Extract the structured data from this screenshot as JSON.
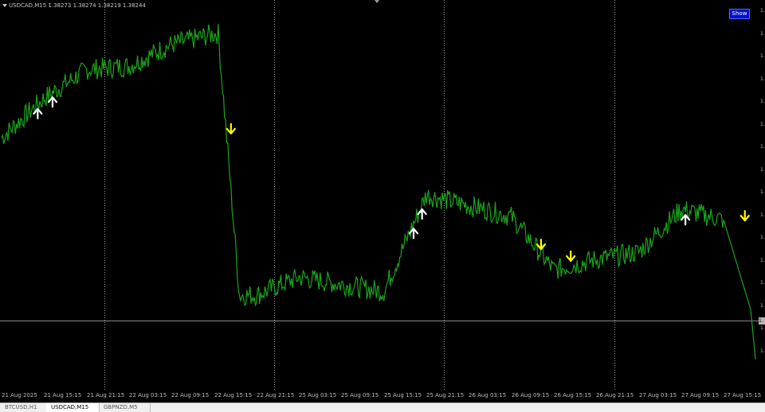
{
  "header": {
    "text": "USDCAD,M15  1.38273 1.38274 1.38219 1.38244"
  },
  "show_button": {
    "label": "Show"
  },
  "price_axis": {
    "ticks": [
      "1.",
      "1.",
      "1.",
      "1.",
      "1.",
      "1.",
      "1.",
      "1.",
      "1.",
      "1.",
      "1.",
      "1.",
      "1.",
      "1.",
      "1.",
      "1."
    ],
    "current_label": "1."
  },
  "time_axis": {
    "labels": [
      "21 Aug 2025",
      "21 Aug 15:15",
      "21 Aug 21:15",
      "22 Aug 03:15",
      "22 Aug 09:15",
      "22 Aug 15:15",
      "22 Aug 21:15",
      "25 Aug 03:15",
      "25 Aug 09:15",
      "25 Aug 15:15",
      "25 Aug 21:15",
      "26 Aug 03:15",
      "26 Aug 09:15",
      "26 Aug 15:15",
      "26 Aug 21:15",
      "27 Aug 03:15",
      "27 Aug 09:15",
      "27 Aug 15:15"
    ]
  },
  "tabs": [
    {
      "label": "BTCUSD,H1",
      "active": false
    },
    {
      "label": "USDCAD,M15",
      "active": true
    },
    {
      "label": "GBPNZD,M5",
      "active": false
    }
  ],
  "colors": {
    "line": "#1aa51a",
    "up_arrow": "#ffffff",
    "down_arrow": "#ffff00",
    "grid": "#9a9a9a",
    "background": "#000000"
  },
  "chart_data": {
    "type": "line",
    "symbol": "USDCAD",
    "timeframe": "M15",
    "ohlc_last": {
      "open": 1.38273,
      "high": 1.38274,
      "low": 1.38219,
      "close": 1.38244
    },
    "x": [
      "21 Aug 2025",
      "21 Aug 15:15",
      "21 Aug 21:15",
      "22 Aug 03:15",
      "22 Aug 09:15",
      "22 Aug 15:15",
      "22 Aug 21:15",
      "25 Aug 03:15",
      "25 Aug 09:15",
      "25 Aug 15:15",
      "25 Aug 21:15",
      "26 Aug 03:15",
      "26 Aug 09:15",
      "26 Aug 15:15",
      "26 Aug 21:15",
      "27 Aug 03:15",
      "27 Aug 09:15",
      "27 Aug 15:15"
    ],
    "values": [
      0.66,
      0.77,
      0.85,
      0.86,
      0.92,
      0.95,
      0.22,
      0.27,
      0.25,
      0.23,
      0.5,
      0.47,
      0.44,
      0.29,
      0.32,
      0.34,
      0.46,
      0.43
    ],
    "value_scale": "normalized 0-1 (price axis labels truncated in screenshot)",
    "signals": [
      {
        "x_index": 0.85,
        "type": "buy"
      },
      {
        "x_index": 1.2,
        "type": "buy"
      },
      {
        "x_index": 5.4,
        "type": "sell"
      },
      {
        "x_index": 9.7,
        "type": "buy"
      },
      {
        "x_index": 9.9,
        "type": "buy"
      },
      {
        "x_index": 12.7,
        "type": "sell"
      },
      {
        "x_index": 13.4,
        "type": "sell"
      },
      {
        "x_index": 16.1,
        "type": "buy"
      },
      {
        "x_index": 17.5,
        "type": "sell"
      }
    ],
    "grid": "vertical dotted separators"
  }
}
